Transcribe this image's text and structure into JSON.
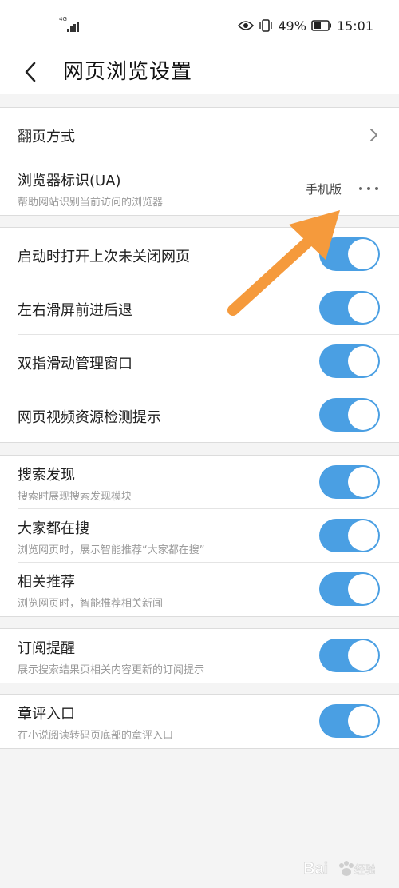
{
  "status_bar": {
    "network": "4G",
    "battery": "49%",
    "time": "15:01"
  },
  "header": {
    "title": "网页浏览设置"
  },
  "groups": [
    {
      "rows": [
        {
          "title": "翻页方式"
        },
        {
          "title": "浏览器标识(UA)",
          "subtitle": "帮助网站识别当前访问的浏览器",
          "value": "手机版"
        }
      ]
    },
    {
      "rows": [
        {
          "title": "启动时打开上次未关闭网页",
          "toggle": true
        },
        {
          "title": "左右滑屏前进后退",
          "toggle": true
        },
        {
          "title": "双指滑动管理窗口",
          "toggle": true
        },
        {
          "title": "网页视频资源检测提示",
          "toggle": true
        }
      ]
    },
    {
      "rows": [
        {
          "title": "搜索发现",
          "subtitle": "搜索时展现搜索发现模块",
          "toggle": true
        },
        {
          "title": "大家都在搜",
          "subtitle": "浏览网页时，展示智能推荐“大家都在搜”",
          "toggle": true
        },
        {
          "title": "相关推荐",
          "subtitle": "浏览网页时，智能推荐相关新闻",
          "toggle": true
        }
      ]
    },
    {
      "rows": [
        {
          "title": "订阅提醒",
          "subtitle": "展示搜索结果页相关内容更新的订阅提示",
          "toggle": true
        }
      ]
    },
    {
      "rows": [
        {
          "title": "章评入口",
          "subtitle": "在小说阅读转码页底部的章评入口",
          "toggle": true
        }
      ]
    }
  ],
  "colors": {
    "toggle_on": "#4a9fe3",
    "arrow": "#f59a3c"
  },
  "icons": {
    "back": "chevron-left-icon",
    "row_nav": "chevron-right-icon",
    "more": "more-horizontal-icon",
    "signal": "signal-icon",
    "eye": "eye-icon",
    "vibrate": "vibrate-icon",
    "battery": "battery-icon",
    "annotation": "arrow-annotation-icon",
    "watermark": "baidu-logo"
  },
  "watermark": {
    "text": "Bai 经验"
  }
}
